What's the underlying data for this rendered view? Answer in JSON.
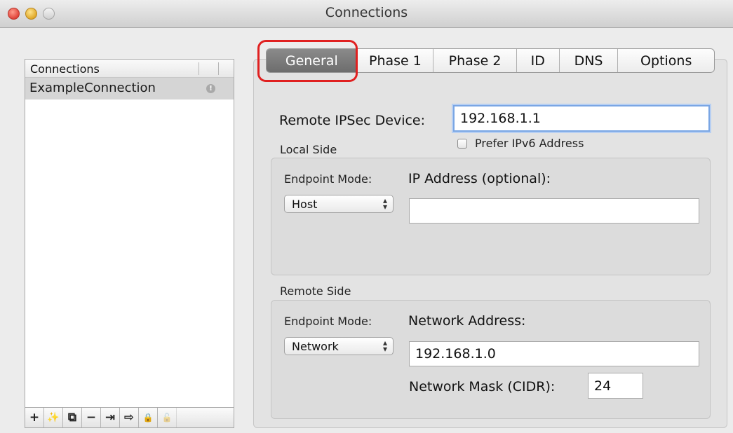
{
  "window": {
    "title": "Connections"
  },
  "sidebar": {
    "header": "Connections",
    "items": [
      {
        "label": "ExampleConnection",
        "badge": "!"
      }
    ],
    "toolbar": [
      {
        "name": "add-button",
        "glyph": "+"
      },
      {
        "name": "wizard-button",
        "glyph": "✨"
      },
      {
        "name": "duplicate-button",
        "glyph": "⧉"
      },
      {
        "name": "remove-button",
        "glyph": "−"
      },
      {
        "name": "import-button",
        "glyph": "⇥"
      },
      {
        "name": "export-button",
        "glyph": "⇨"
      },
      {
        "name": "lock-button",
        "glyph": "🔒"
      },
      {
        "name": "unlock-button",
        "glyph": "🔓"
      }
    ]
  },
  "tabs": [
    {
      "label": "General",
      "active": true
    },
    {
      "label": "Phase 1"
    },
    {
      "label": "Phase 2"
    },
    {
      "label": "ID"
    },
    {
      "label": "DNS"
    },
    {
      "label": "Options"
    }
  ],
  "general": {
    "remote_device_label": "Remote IPSec Device:",
    "remote_device_value": "192.168.1.1",
    "prefer_ipv6_label": "Prefer IPv6 Address",
    "local_side": {
      "title": "Local Side",
      "endpoint_mode_label": "Endpoint Mode:",
      "endpoint_mode_value": "Host",
      "ip_address_label": "IP Address (optional):",
      "ip_address_value": ""
    },
    "remote_side": {
      "title": "Remote Side",
      "endpoint_mode_label": "Endpoint Mode:",
      "endpoint_mode_value": "Network",
      "network_address_label": "Network Address:",
      "network_address_value": "192.168.1.0",
      "network_mask_label": "Network Mask (CIDR):",
      "network_mask_value": "24"
    }
  },
  "colors": {
    "highlight": "#e02020",
    "active_tab": "#7a7a7a",
    "focus_ring": "#7aa6e4"
  }
}
